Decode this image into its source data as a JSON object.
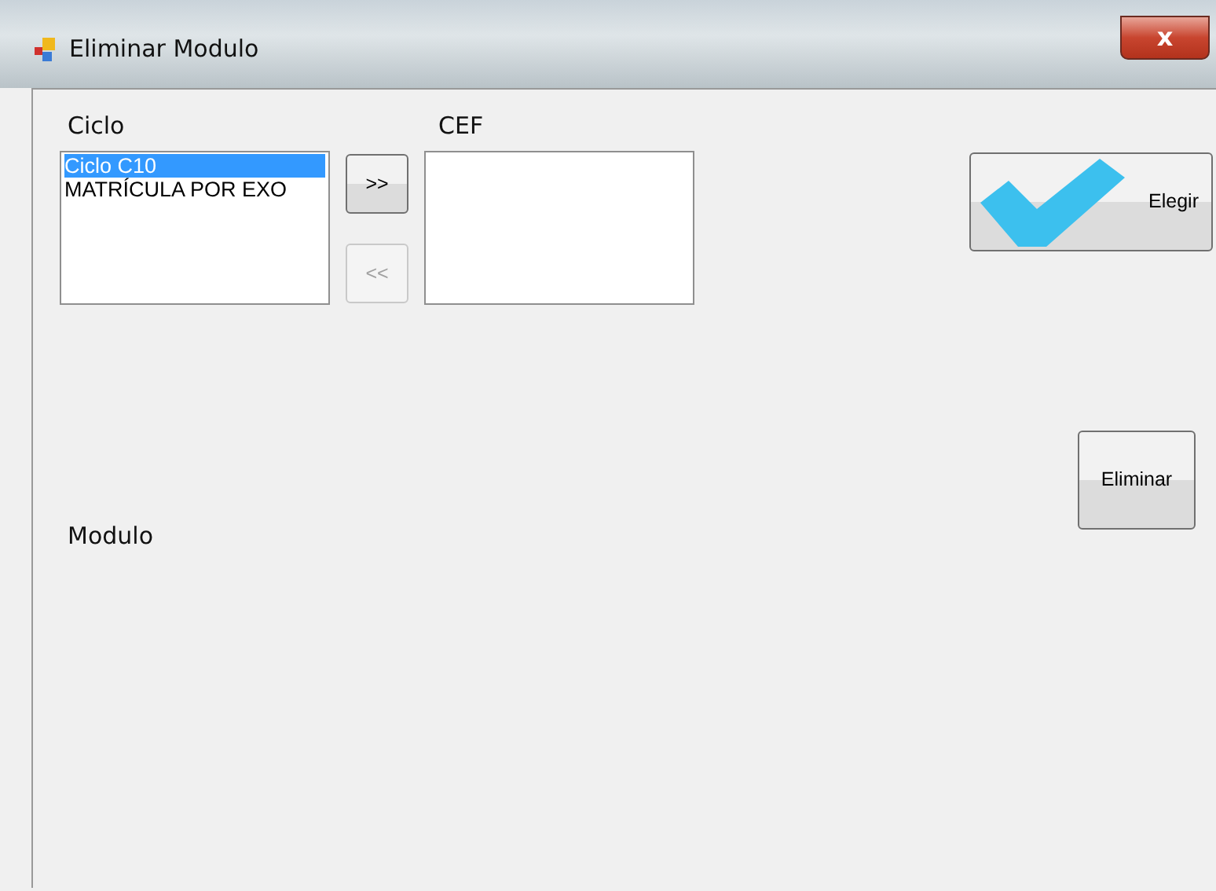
{
  "window": {
    "title": "Eliminar Modulo",
    "close_label": "x"
  },
  "ciclo": {
    "label": "Ciclo",
    "items": [
      {
        "text": "Ciclo C10",
        "selected": true
      },
      {
        "text": "MATRÍCULA POR EXO",
        "selected": false
      }
    ]
  },
  "move_buttons": [
    {
      "label": ">>",
      "disabled": false
    },
    {
      "label": "<<",
      "disabled": true
    }
  ],
  "cef": {
    "label": "CEF"
  },
  "elegir_button": {
    "label": "Elegir"
  },
  "eliminar_button": {
    "label": "Eliminar"
  },
  "modulo": {
    "label": "Modulo"
  }
}
